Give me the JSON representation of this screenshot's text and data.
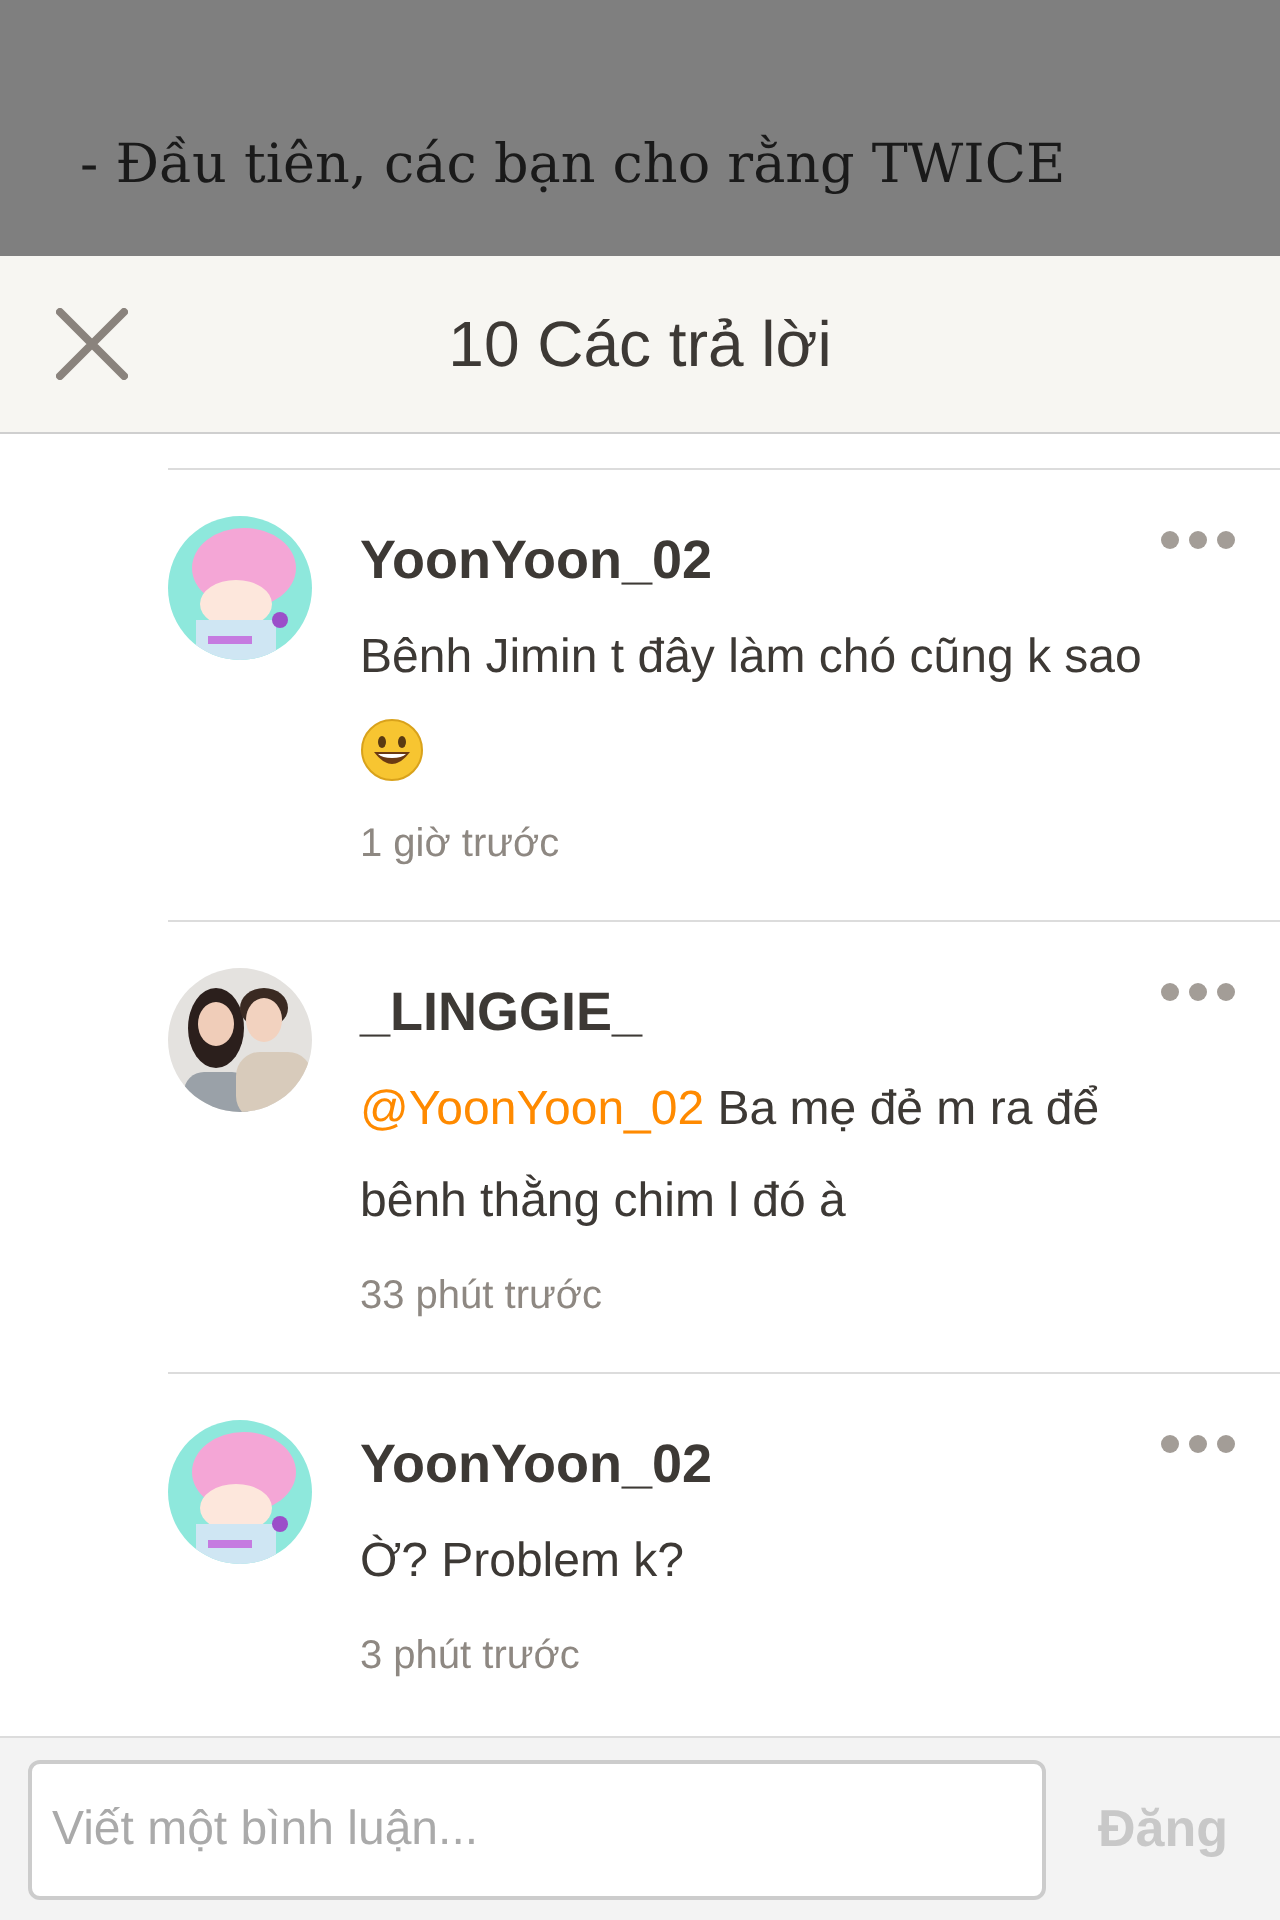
{
  "background_article": {
    "lines": [
      "- Đầu tiên, các bạn cho rằng TWICE"
    ]
  },
  "header": {
    "title": "10 Các trả lời"
  },
  "comments": [
    {
      "author": "YoonYoon_02",
      "text": "Bênh Jimin t đây làm chó cũng k sao",
      "emoji": true,
      "time": "1 giờ trước"
    },
    {
      "author": "_LINGGIE_",
      "mention": "@YoonYoon_02",
      "text": "Ba mẹ đẻ m ra để bênh thằng chim l đó à",
      "emoji": false,
      "time": "33 phút trước"
    },
    {
      "author": "YoonYoon_02",
      "text": "Ờ? Problem k?",
      "emoji": false,
      "time": "3 phút trước"
    }
  ],
  "composer": {
    "placeholder": "Viết một bình luận...",
    "post_button": {
      "label": "Đăng",
      "disabled": true
    }
  }
}
